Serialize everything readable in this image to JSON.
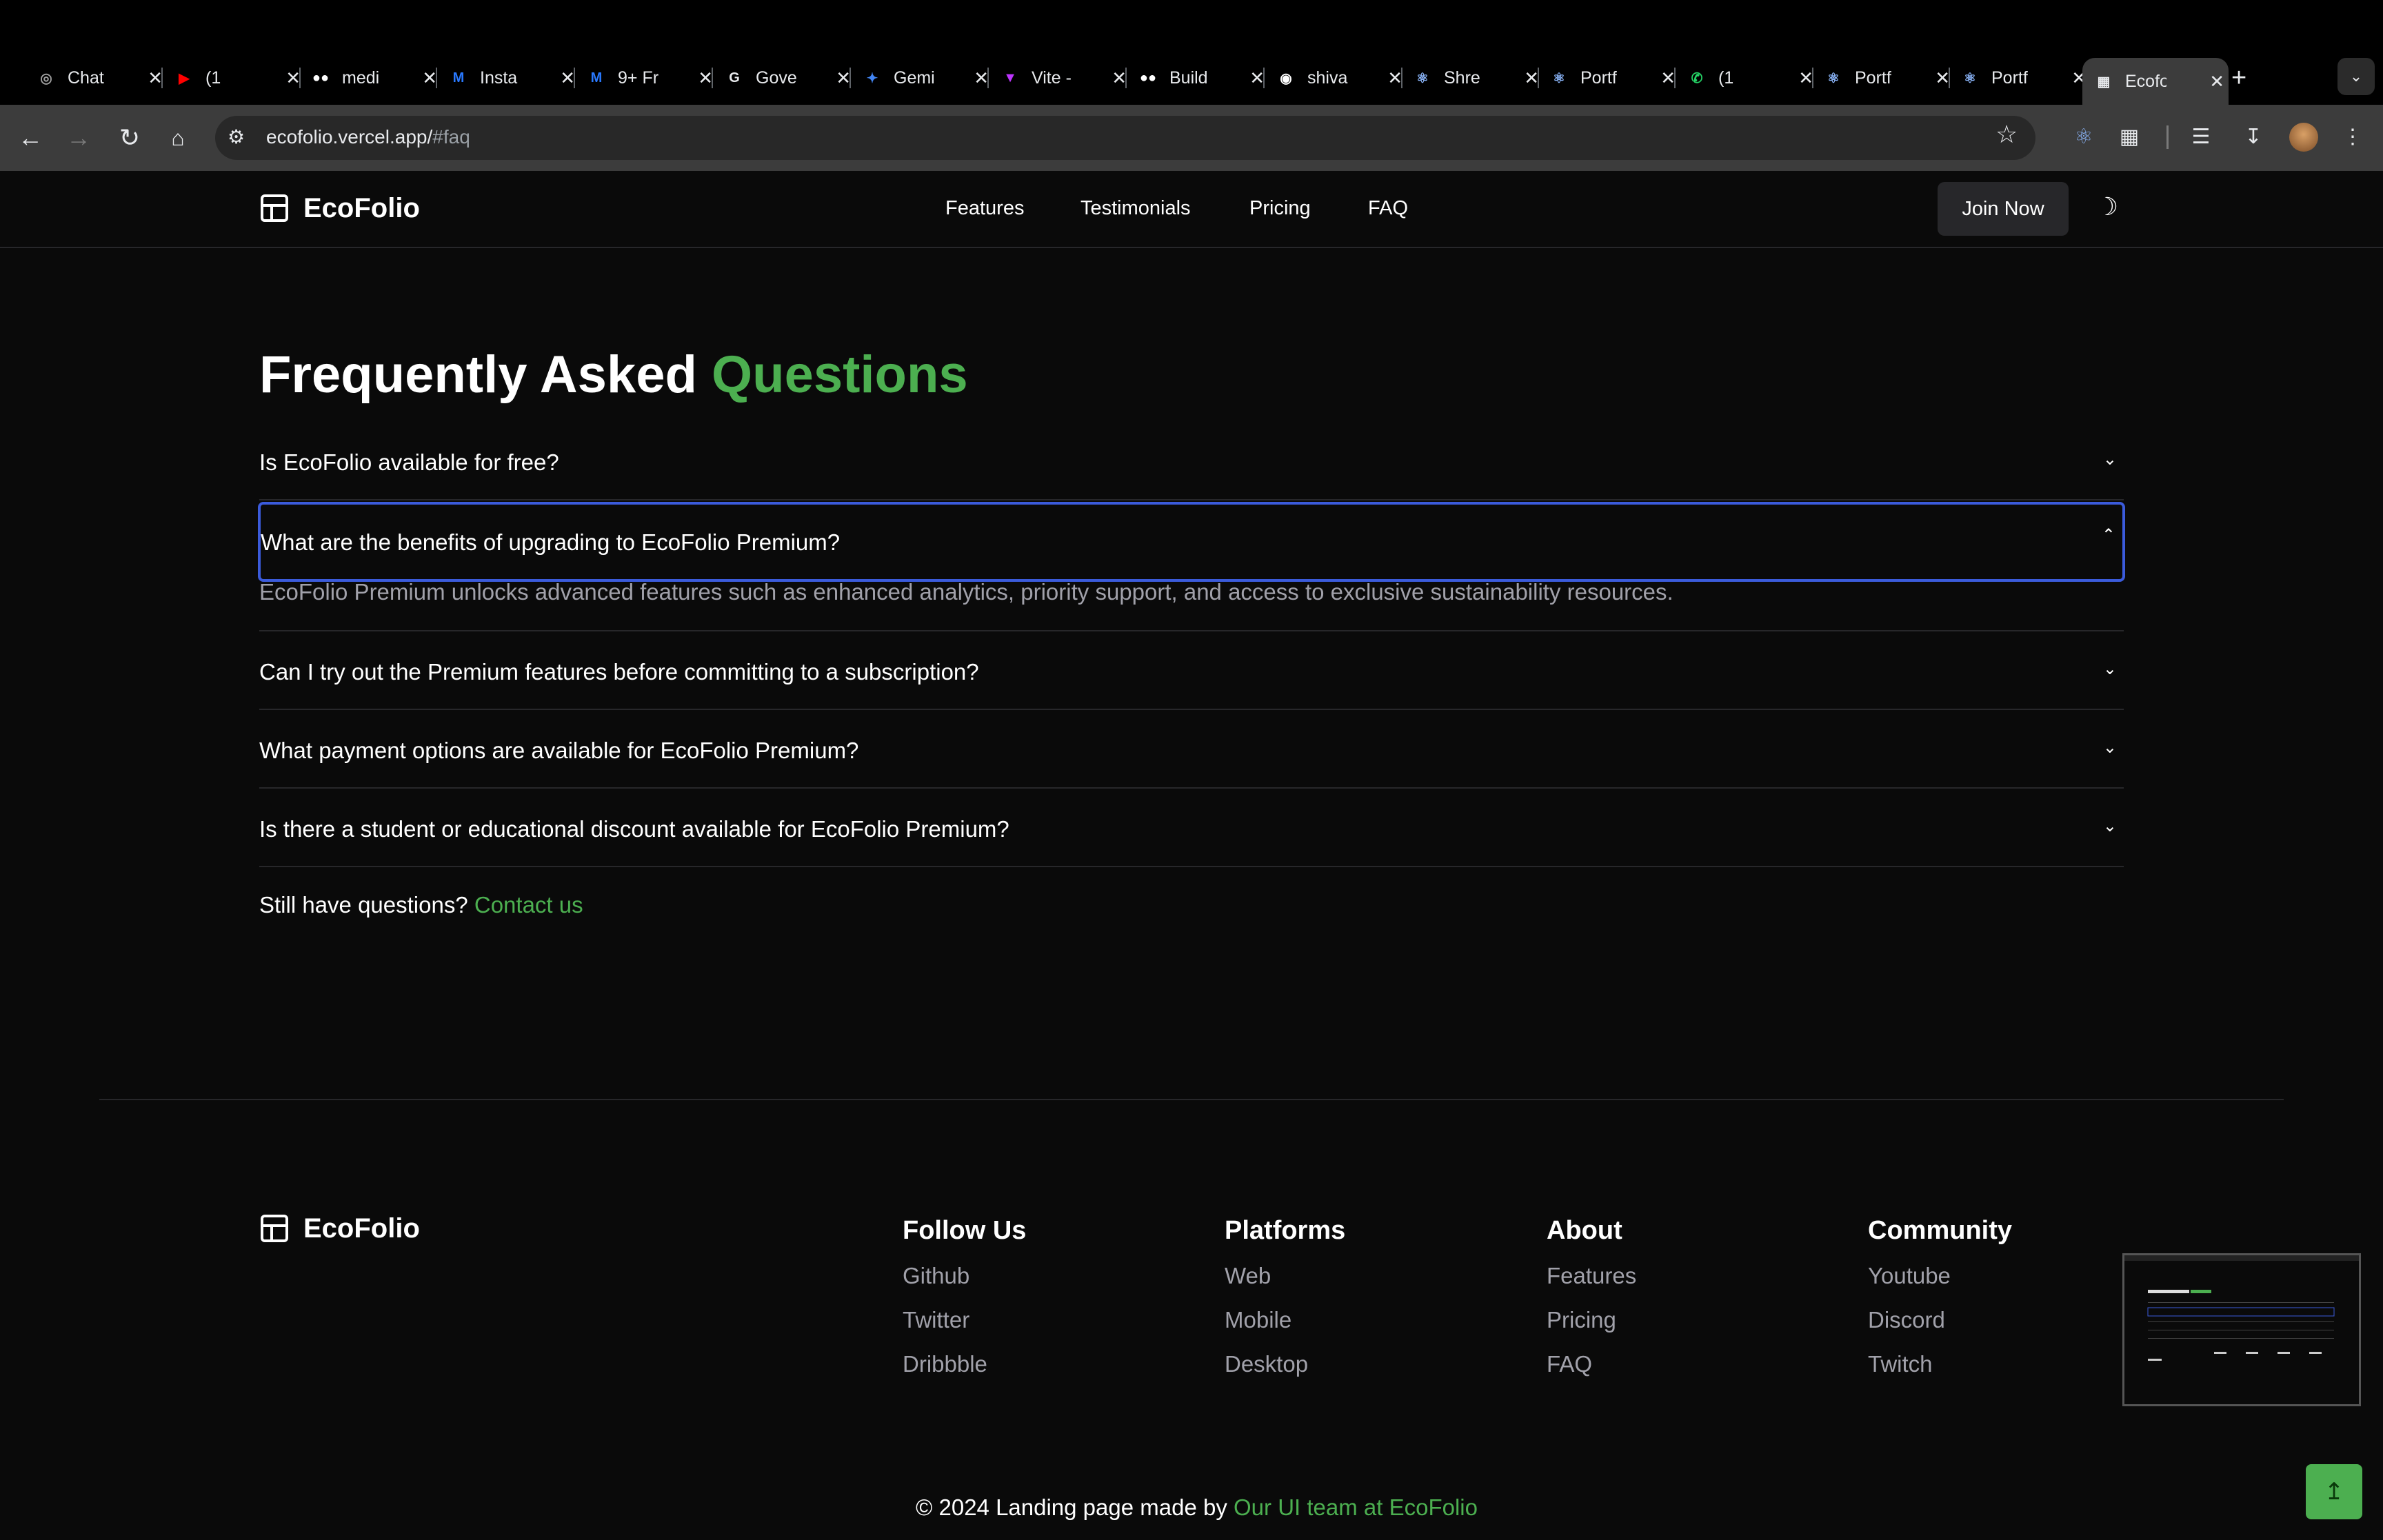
{
  "browser": {
    "tabs": [
      {
        "title": "Chat",
        "icon": "chatgpt-icon",
        "color": "#9e9e9e"
      },
      {
        "title": "(1",
        "icon": "youtube-icon",
        "color": "#ff0000"
      },
      {
        "title": "medi",
        "icon": "medium-icon",
        "color": "#ffffff"
      },
      {
        "title": "Insta",
        "icon": "material-icon",
        "color": "#2979ff"
      },
      {
        "title": "9+ Fr",
        "icon": "material-icon",
        "color": "#2979ff"
      },
      {
        "title": "Gove",
        "icon": "gov-icon",
        "color": "#e8eaed"
      },
      {
        "title": "Gemi",
        "icon": "gemini-icon",
        "color": "#4285f4"
      },
      {
        "title": "Vite -",
        "icon": "vite-icon",
        "color": "#bd34fe"
      },
      {
        "title": "Build",
        "icon": "medium-icon",
        "color": "#ffffff"
      },
      {
        "title": "shiva",
        "icon": "github-icon",
        "color": "#ffffff"
      },
      {
        "title": "Shre",
        "icon": "react-icon",
        "color": "#8ab4f8"
      },
      {
        "title": "Portf",
        "icon": "react-icon",
        "color": "#8ab4f8"
      },
      {
        "title": "(1",
        "icon": "whatsapp-icon",
        "color": "#25d366"
      },
      {
        "title": "Portf",
        "icon": "react-icon",
        "color": "#8ab4f8"
      },
      {
        "title": "Portf",
        "icon": "react-icon",
        "color": "#8ab4f8"
      },
      {
        "title": "Ecofo",
        "icon": "layout-icon",
        "color": "#e8eaed",
        "active": true
      }
    ],
    "url_host": "ecofolio.vercel.app/",
    "url_path": "#faq"
  },
  "nav": {
    "brand": "EcoFolio",
    "links": [
      "Features",
      "Testimonials",
      "Pricing",
      "FAQ"
    ],
    "cta": "Join Now"
  },
  "faq": {
    "title_main": "Frequently Asked ",
    "title_accent": "Questions",
    "accent_color": "#4caf50",
    "items": [
      {
        "q": "Is EcoFolio available for free?",
        "open": false
      },
      {
        "q": "What are the benefits of upgrading to EcoFolio Premium?",
        "open": true,
        "a": "EcoFolio Premium unlocks advanced features such as enhanced analytics, priority support, and access to exclusive sustainability resources."
      },
      {
        "q": "Can I try out the Premium features before committing to a subscription?",
        "open": false
      },
      {
        "q": "What payment options are available for EcoFolio Premium?",
        "open": false
      },
      {
        "q": "Is there a student or educational discount available for EcoFolio Premium?",
        "open": false
      }
    ],
    "still_text": "Still have questions? ",
    "contact_link": "Contact us"
  },
  "footer": {
    "brand": "EcoFolio",
    "columns": [
      {
        "heading": "Follow Us",
        "links": [
          "Github",
          "Twitter",
          "Dribbble"
        ]
      },
      {
        "heading": "Platforms",
        "links": [
          "Web",
          "Mobile",
          "Desktop"
        ]
      },
      {
        "heading": "About",
        "links": [
          "Features",
          "Pricing",
          "FAQ"
        ]
      },
      {
        "heading": "Community",
        "links": [
          "Youtube",
          "Discord",
          "Twitch"
        ]
      }
    ],
    "copyright": "© 2024 Landing page made by ",
    "copyright_link": "Our UI team at EcoFolio"
  }
}
